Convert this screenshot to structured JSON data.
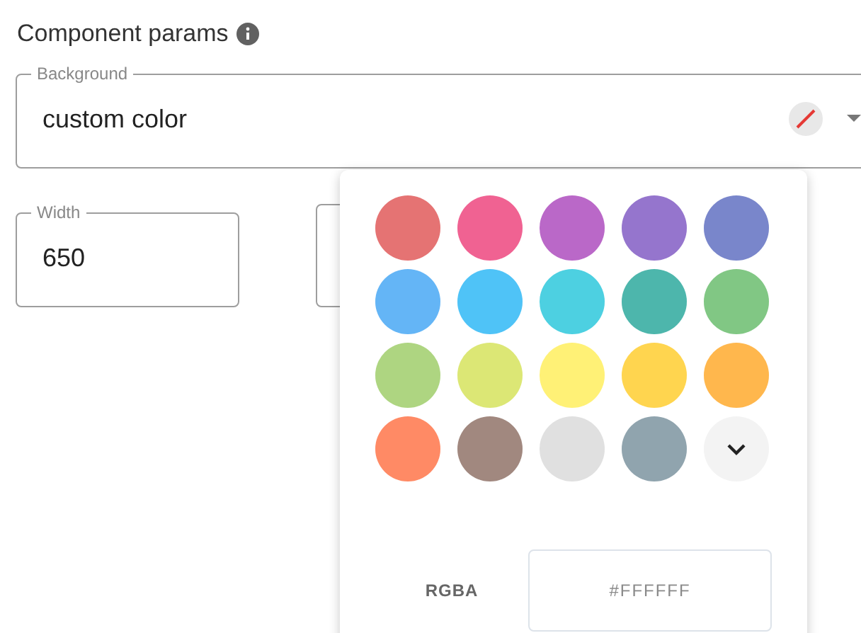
{
  "section": {
    "title": "Component params"
  },
  "fields": [
    {
      "kind": "select",
      "label": "Background",
      "value": "custom color"
    },
    {
      "kind": "text",
      "label": "Width",
      "value": "650"
    },
    {
      "kind": "blank"
    }
  ],
  "picker": {
    "swatches": [
      {
        "kind": "swatch",
        "color": "#e57373"
      },
      {
        "kind": "swatch",
        "color": "#f06292"
      },
      {
        "kind": "swatch",
        "color": "#ba68c8"
      },
      {
        "kind": "swatch",
        "color": "#9575cd"
      },
      {
        "kind": "swatch",
        "color": "#7986cb"
      },
      {
        "kind": "swatch",
        "color": "#64b5f6"
      },
      {
        "kind": "swatch",
        "color": "#4fc3f7"
      },
      {
        "kind": "swatch",
        "color": "#4dd0e1"
      },
      {
        "kind": "swatch",
        "color": "#4db6ac"
      },
      {
        "kind": "swatch",
        "color": "#81c784"
      },
      {
        "kind": "swatch",
        "color": "#aed581"
      },
      {
        "kind": "swatch",
        "color": "#dce775"
      },
      {
        "kind": "swatch",
        "color": "#fff176"
      },
      {
        "kind": "swatch",
        "color": "#ffd54f"
      },
      {
        "kind": "swatch",
        "color": "#ffb74d"
      },
      {
        "kind": "swatch",
        "color": "#ff8a65"
      },
      {
        "kind": "swatch",
        "color": "#a1887f"
      },
      {
        "kind": "swatch",
        "color": "#e0e0e0"
      },
      {
        "kind": "swatch",
        "color": "#90a4ae"
      },
      {
        "kind": "more"
      }
    ],
    "format": "RGBA",
    "hex": {
      "placeholder": "#FFFFFF"
    }
  }
}
